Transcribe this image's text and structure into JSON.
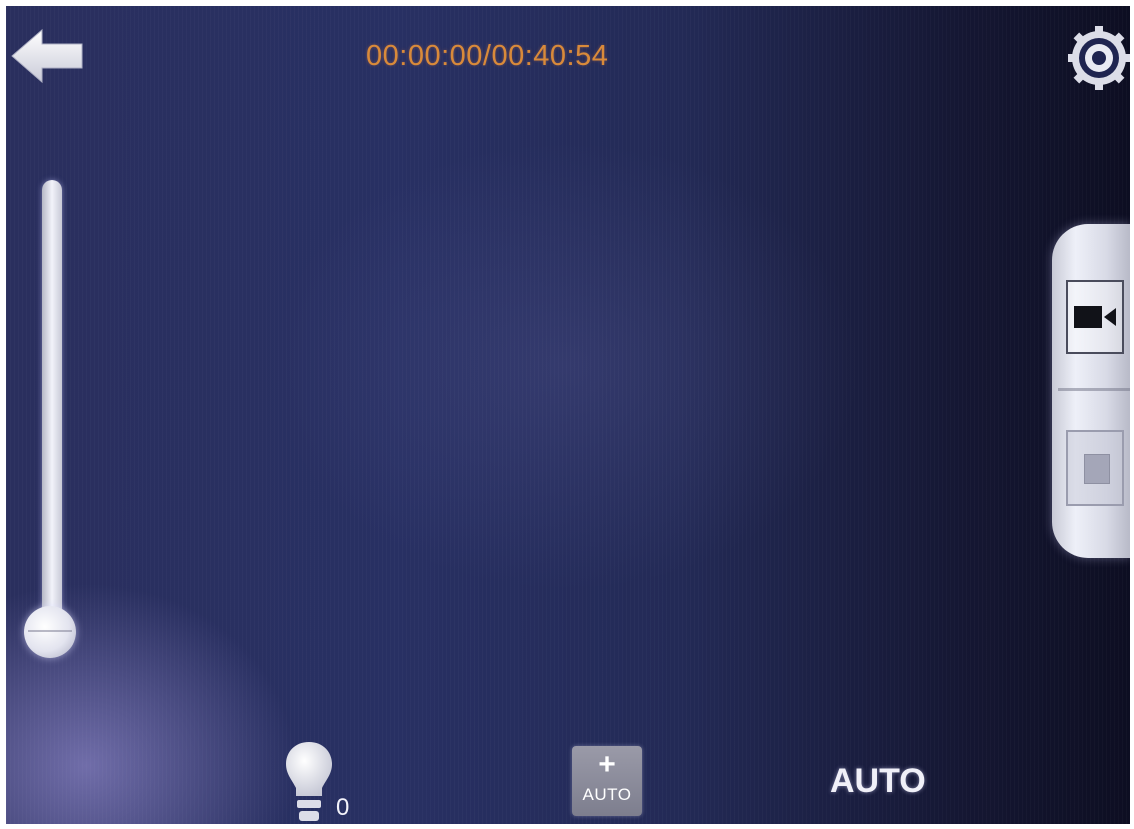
{
  "status": {
    "timecode": "00:00:00/00:40:54"
  },
  "top_bar": {
    "back_icon": "back-arrow-icon",
    "settings_icon": "gear-icon"
  },
  "zoom_slider": {
    "level": 0.0
  },
  "mode_selector": {
    "options": [
      {
        "icon": "video-camera-icon",
        "selected": true
      },
      {
        "icon": "photo-mode-icon",
        "selected": false
      }
    ]
  },
  "bottom_bar": {
    "light": {
      "icon": "lightbulb-icon",
      "level": "0"
    },
    "exposure": {
      "plus_label": "+",
      "auto_label": "AUTO"
    },
    "white_balance": {
      "label": "AUTO"
    }
  },
  "colors": {
    "timecode": "#d98a3a",
    "controls": "#e6e7f2",
    "background": "#232a56"
  }
}
